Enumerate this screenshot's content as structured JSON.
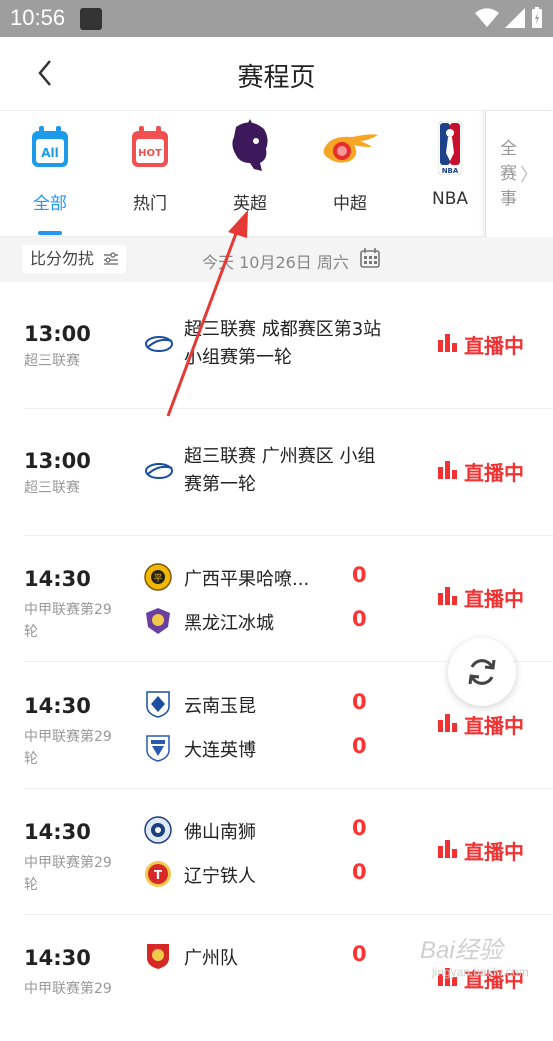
{
  "status": {
    "time": "10:56"
  },
  "nav": {
    "title": "赛程页"
  },
  "categories": [
    {
      "label": "全部",
      "icon": "all-icon",
      "badge": "All"
    },
    {
      "label": "热门",
      "icon": "hot-icon",
      "badge": "HOT"
    },
    {
      "label": "英超",
      "icon": "premier-league-icon"
    },
    {
      "label": "中超",
      "icon": "csl-icon"
    },
    {
      "label": "NBA",
      "icon": "nba-icon"
    }
  ],
  "all_categories": {
    "label": "全赛事"
  },
  "filter": {
    "label": "比分勿扰",
    "date": "今天 10月26日 周六"
  },
  "matches": [
    {
      "time": "13:00",
      "league": "超三联赛",
      "title": "超三联赛 成都赛区第3站 小组赛第一轮",
      "status": "直播中"
    },
    {
      "time": "13:00",
      "league": "超三联赛",
      "title": "超三联赛 广州赛区 小组赛第一轮",
      "status": "直播中"
    },
    {
      "time": "14:30",
      "league": "中甲联赛第29轮",
      "home": "广西平果哈嘹...",
      "home_score": "0",
      "away": "黑龙江冰城",
      "away_score": "0",
      "status": "直播中"
    },
    {
      "time": "14:30",
      "league": "中甲联赛第29轮",
      "home": "云南玉昆",
      "home_score": "0",
      "away": "大连英博",
      "away_score": "0",
      "status": "直播中"
    },
    {
      "time": "14:30",
      "league": "中甲联赛第29轮",
      "home": "佛山南狮",
      "home_score": "0",
      "away": "辽宁铁人",
      "away_score": "0",
      "status": "直播中"
    },
    {
      "time": "14:30",
      "league": "中甲联赛第29",
      "home": "广州队",
      "home_score": "0",
      "status": "直播中"
    }
  ],
  "watermark": {
    "brand": "Bai经验",
    "sub": "jingyan.baidu.com"
  },
  "colors": {
    "accent": "#2196f3",
    "live": "#f03232"
  }
}
